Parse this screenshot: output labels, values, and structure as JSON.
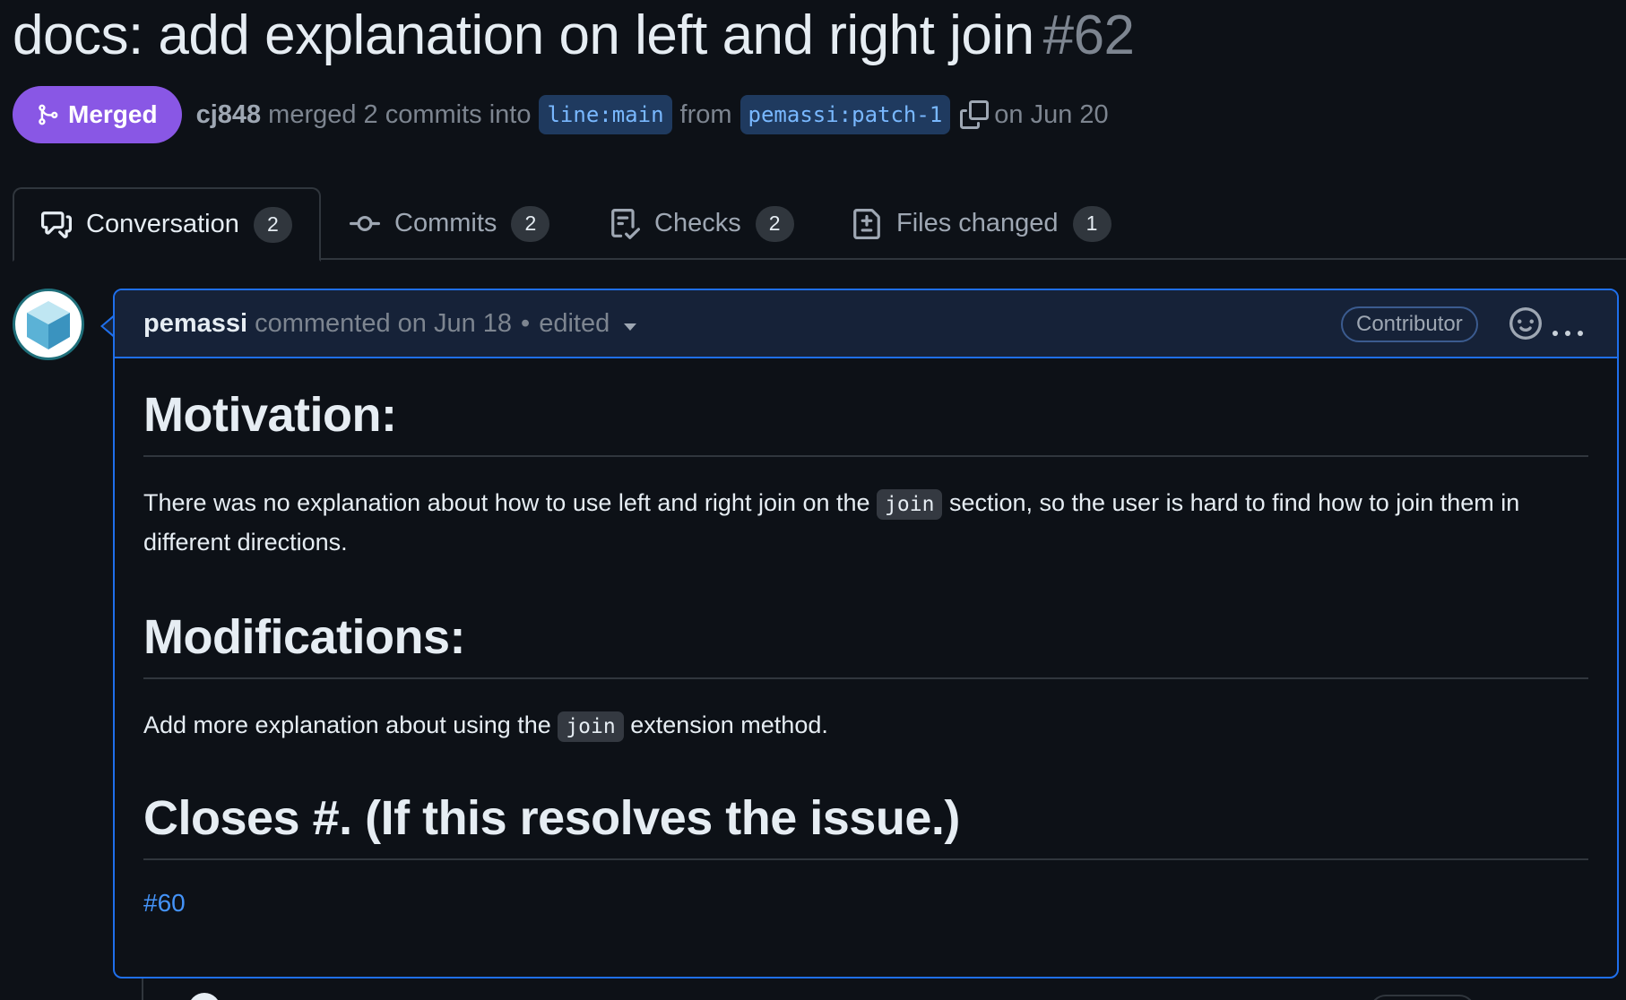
{
  "pr": {
    "title": "docs: add explanation on left and right join",
    "number": "#62",
    "state": "Merged",
    "merged_by": "cj848",
    "merge_text": "merged 2 commits into",
    "base_branch": "line:main",
    "from_text": "from",
    "head_branch": "pemassi:patch-1",
    "date_text": "on Jun 20"
  },
  "tabs": [
    {
      "label": "Conversation",
      "count": "2",
      "icon": "comment-discussion-icon",
      "active": true
    },
    {
      "label": "Commits",
      "count": "2",
      "icon": "git-commit-icon"
    },
    {
      "label": "Checks",
      "count": "2",
      "icon": "checklist-icon"
    },
    {
      "label": "Files changed",
      "count": "1",
      "icon": "file-diff-icon"
    }
  ],
  "comment": {
    "author": "pemassi",
    "action": "commented on Jun 18",
    "separator": "•",
    "edited": "edited",
    "role": "Contributor",
    "body": {
      "h_motivation": "Motivation:",
      "p1_before": "There was no explanation about how to use left and right join on the ",
      "p1_code": "join",
      "p1_after": " section, so the user is hard to find how to join them in different directions.",
      "h_modifications": "Modifications:",
      "p2_before": "Add more explanation about using the ",
      "p2_code": "join",
      "p2_after": " extension method.",
      "h_closes": "Closes #. (If this resolves the issue.)",
      "issue_link": "#60"
    }
  },
  "colors": {
    "background": "#0d1117",
    "merged": "#8957e5",
    "accent_blue": "#1f6feb",
    "link": "#4493f8"
  }
}
